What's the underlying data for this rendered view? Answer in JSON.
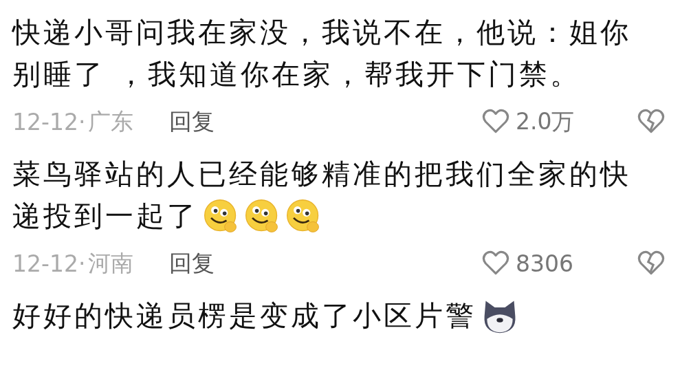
{
  "comments": [
    {
      "lines": [
        "快递小哥问我在家没，我说不在，他说：姐你",
        "别睡了 ，我知道你在家，帮我开下门禁。"
      ],
      "date": "12-12·",
      "region": "广东",
      "reply": "回复",
      "likes": "2.0万"
    },
    {
      "lines": [
        "菜鸟驿站的人已经能够精准的把我们全家的快",
        "递投到一起了"
      ],
      "stickers": [
        {
          "kind": "smiley"
        },
        {
          "kind": "smiley"
        },
        {
          "kind": "smiley"
        }
      ],
      "date": "12-12·",
      "region": "河南",
      "reply": "回复",
      "likes": "8306"
    },
    {
      "lines": [
        "好好的快递员楞是变成了小区片警"
      ],
      "stickers": [
        {
          "kind": "dog"
        }
      ]
    }
  ]
}
